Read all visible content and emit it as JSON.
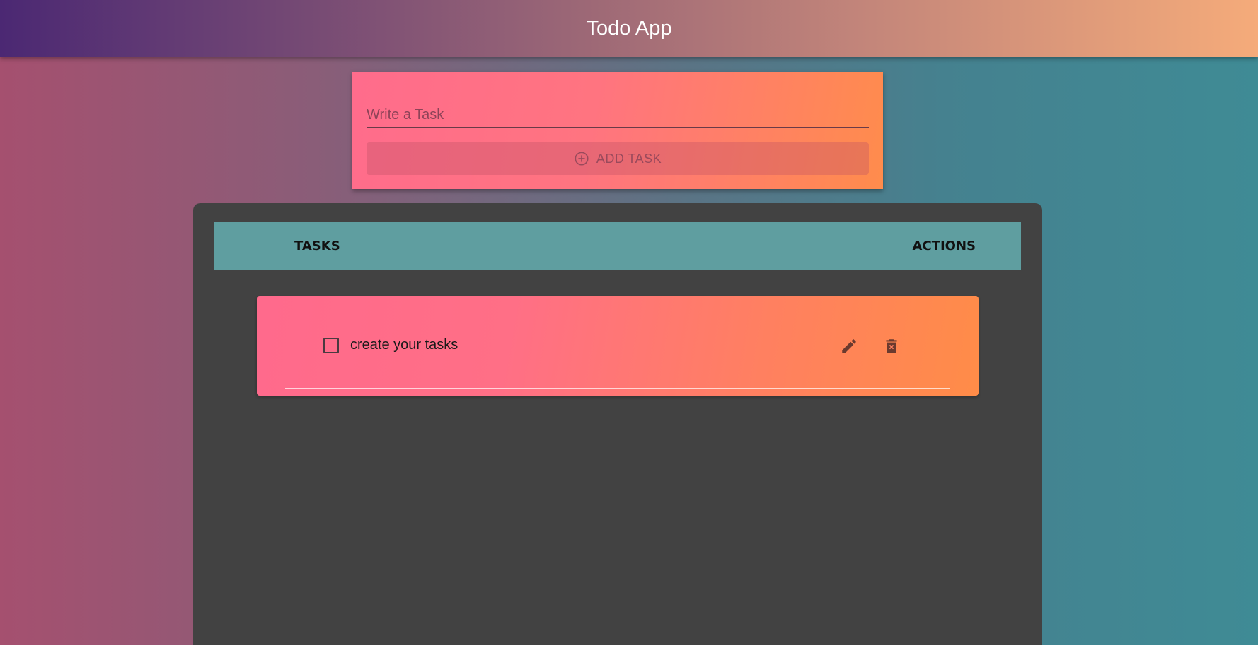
{
  "appbar": {
    "title": "Todo App"
  },
  "form": {
    "placeholder": "Write a Task",
    "add_label": "ADD TASK",
    "add_icon": "add-circle-outline-icon"
  },
  "table": {
    "headers": {
      "tasks": "TASKS",
      "actions": "ACTIONS"
    },
    "header_color": "#5f9ea0",
    "panel_color": "#424242"
  },
  "tasks": [
    {
      "text": "create your tasks",
      "completed": false,
      "edit_icon": "pencil-icon",
      "delete_icon": "trash-x-icon"
    }
  ],
  "colors": {
    "card_start": "#ff6a8c",
    "card_end": "#ff8c48",
    "icon": "#6b3a2e"
  }
}
